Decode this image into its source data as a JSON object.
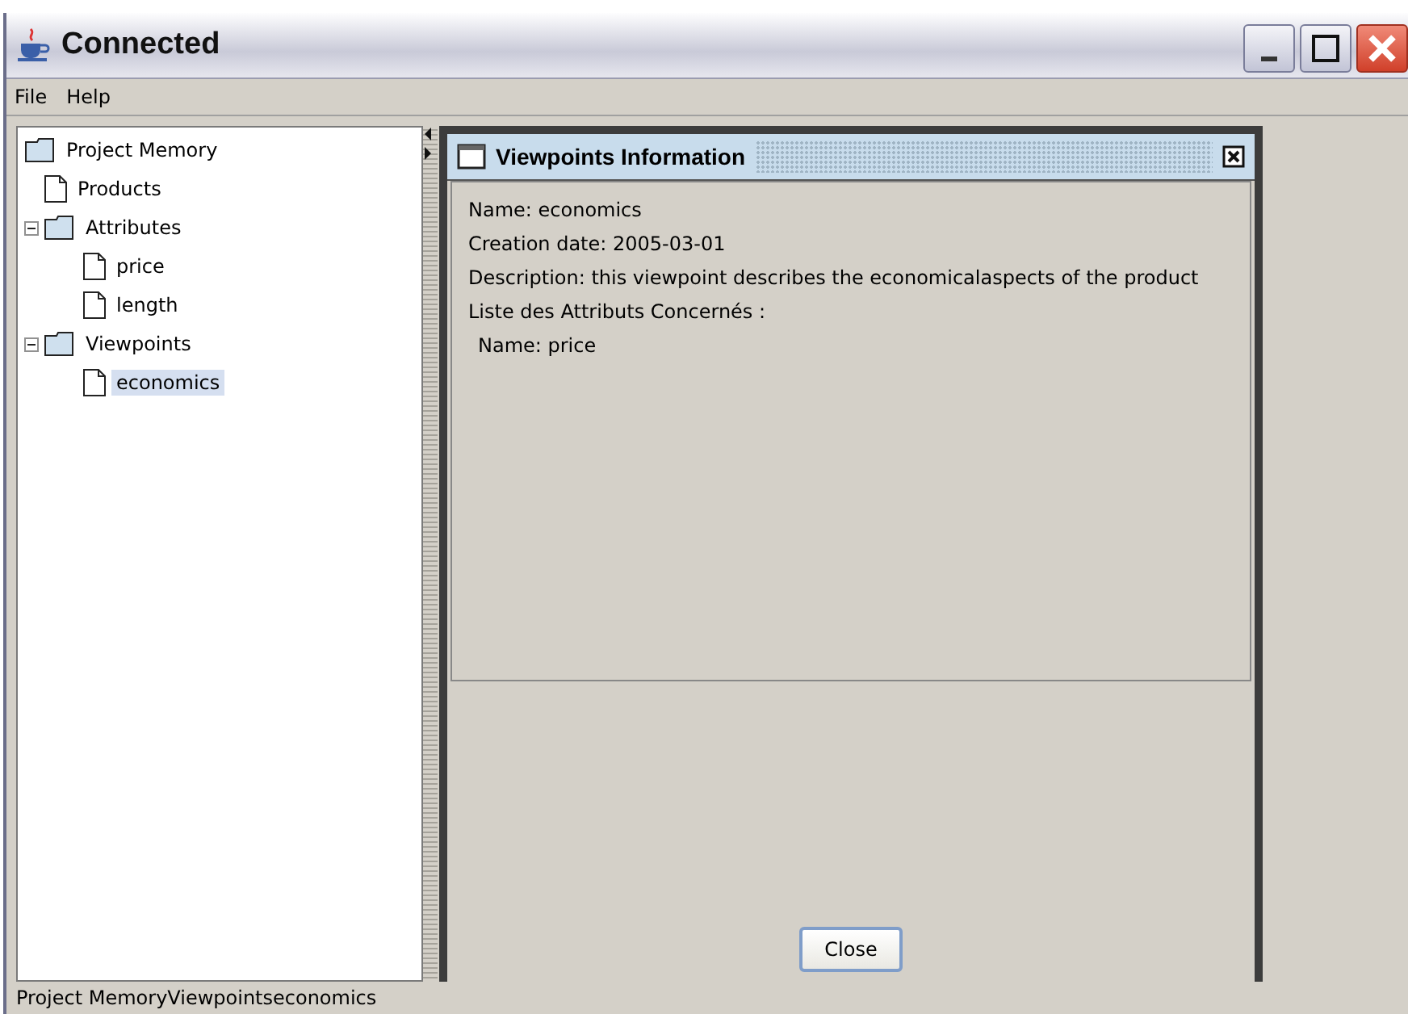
{
  "window": {
    "title": "Connected"
  },
  "menu": [
    "File",
    "Help"
  ],
  "tree": [
    {
      "label": "Project Memory",
      "kind": "folder",
      "selected": false,
      "children": [
        {
          "label": "Products",
          "kind": "file",
          "selected": false
        },
        {
          "label": "Attributes",
          "kind": "folder",
          "expanded": true,
          "selected": false,
          "children": [
            {
              "label": "price",
              "kind": "file",
              "selected": false
            },
            {
              "label": "length",
              "kind": "file",
              "selected": false
            }
          ]
        },
        {
          "label": "Viewpoints",
          "kind": "folder",
          "expanded": true,
          "selected": false,
          "children": [
            {
              "label": "economics",
              "kind": "file",
              "selected": true
            }
          ]
        }
      ]
    }
  ],
  "dialog": {
    "title": "Viewpoints Information",
    "lines": [
      {
        "text": "Name: economics",
        "indent": false
      },
      {
        "text": "Creation date: 2005-03-01",
        "indent": false
      },
      {
        "text": "Description: this viewpoint describes the economicalaspects of the product",
        "indent": false
      },
      {
        "text": "Liste des Attributs Concernés :",
        "indent": false
      },
      {
        "text": "Name: price",
        "indent": true
      }
    ],
    "button": "Close"
  },
  "status_bar": "Project MemoryViewpointseconomics"
}
